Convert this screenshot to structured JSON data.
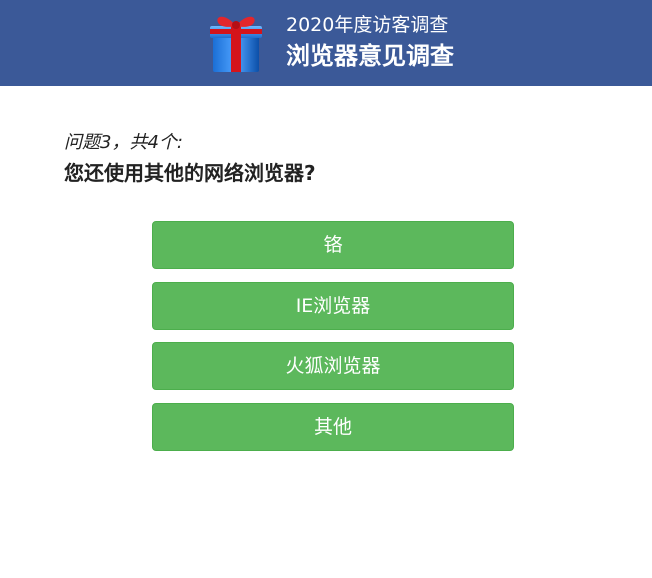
{
  "header": {
    "subtitle": "2020年度访客调查",
    "title": "浏览器意见调查",
    "icon": "gift-box-icon"
  },
  "question": {
    "counter": "问题3，共4个:",
    "text": "您还使用其他的网络浏览器?"
  },
  "options": [
    {
      "label": "铬"
    },
    {
      "label": "IE浏览器"
    },
    {
      "label": "火狐浏览器"
    },
    {
      "label": "其他"
    }
  ],
  "colors": {
    "header_bg": "#3b5998",
    "button_bg": "#5cb85c",
    "button_text": "#ffffff"
  }
}
